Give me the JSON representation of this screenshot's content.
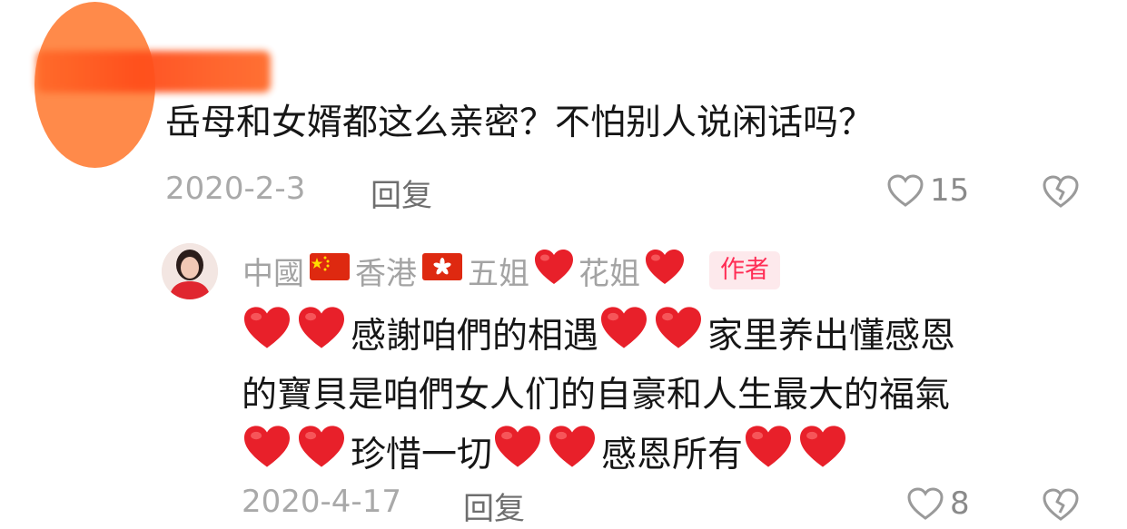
{
  "comment": {
    "text": "岳母和女婿都这么亲密？不怕别人说闲话吗？",
    "date": "2020-2-3",
    "reply_label": "回复",
    "like_count": "15"
  },
  "reply": {
    "author_parts": [
      "中國",
      "香港",
      "五姐",
      "花姐"
    ],
    "author_badge": "作者",
    "line1": [
      "感謝咱們的相遇",
      "家里养出懂感恩"
    ],
    "line2": "的寶貝是咱們女人们的自豪和人生最大的福氣",
    "line3": [
      "珍惜一切",
      "感恩所有"
    ],
    "date": "2020-4-17",
    "reply_label": "回复",
    "like_count": "8"
  },
  "colors": {
    "heart_red": "#e8202a",
    "badge_text": "#ff2d55",
    "badge_bg": "#fde9ec",
    "avatar_blob": "#ff8a4a"
  },
  "icons": {
    "like": "heart-outline-icon",
    "dislike": "broken-heart-outline-icon",
    "emoji": "red-heart-emoji",
    "flag_cn": "china-flag-icon",
    "flag_hk": "hong-kong-flag-icon"
  }
}
